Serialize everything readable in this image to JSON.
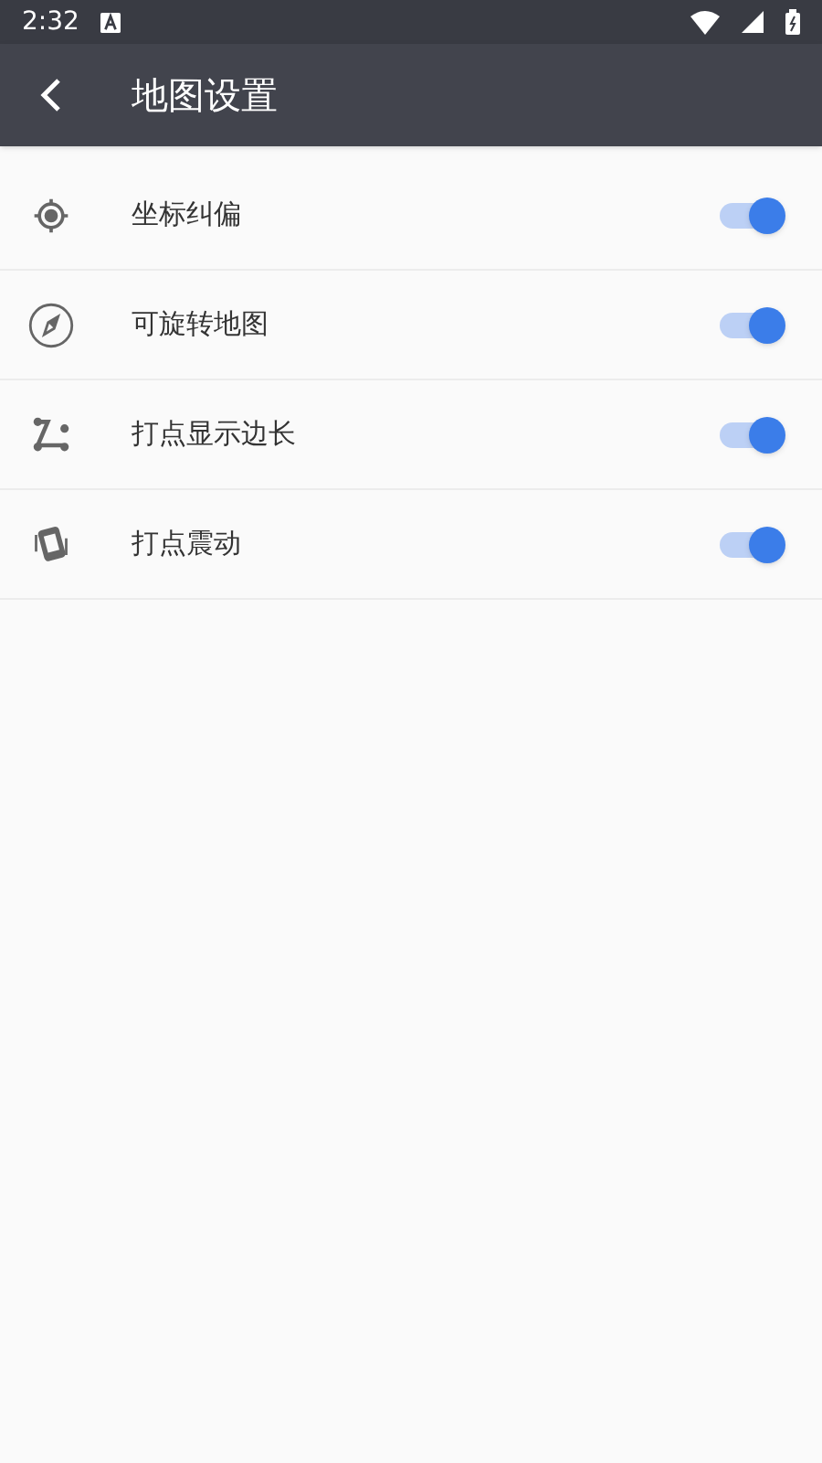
{
  "status_bar": {
    "time": "2:32"
  },
  "app_bar": {
    "title": "地图设置"
  },
  "settings": [
    {
      "kind": "crosshair",
      "label": "坐标纠偏",
      "on": true
    },
    {
      "kind": "compass",
      "label": "可旋转地图",
      "on": true
    },
    {
      "kind": "polyline",
      "label": "打点显示边长",
      "on": true
    },
    {
      "kind": "vibrate",
      "label": "打点震动",
      "on": true
    }
  ]
}
